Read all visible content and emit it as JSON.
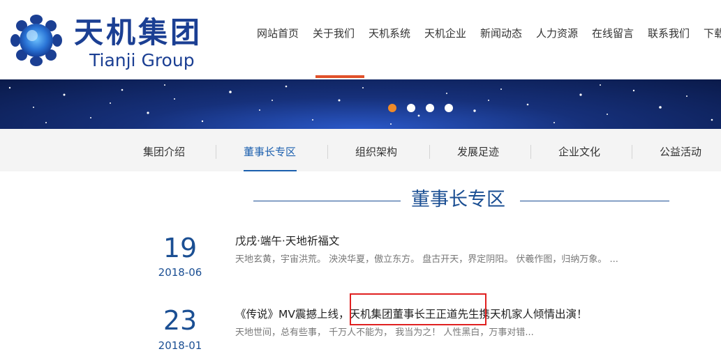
{
  "header": {
    "logo_cn": "天机集团",
    "logo_en": "Tianji Group",
    "nav": [
      "网站首页",
      "关于我们",
      "天机系统",
      "天机企业",
      "新闻动态",
      "人力资源",
      "在线留言",
      "联系我们",
      "下载"
    ]
  },
  "banner": {
    "active_slide": 1,
    "slide_count": 4
  },
  "subnav": [
    "集团介绍",
    "董事长专区",
    "组织架构",
    "发展足迹",
    "企业文化",
    "公益活动"
  ],
  "section": {
    "title": "董事长专区"
  },
  "articles": [
    {
      "day": "19",
      "ym": "2018-06",
      "title": "戊戌·端午·天地祈福文",
      "desc": "天地玄黄，宇宙洪荒。 泱泱华夏，傲立东方。 盘古开天，界定阴阳。 伏羲作图，归纳万象。 ..."
    },
    {
      "day": "23",
      "ym": "2018-01",
      "title": "《传说》MV震撼上线，天机集团董事长王正道先生携天机家人倾情出演！",
      "desc": "天地世间，总有些事， 千万人不能为， 我当为之！ 人性黑白，万事对错..."
    }
  ],
  "colors": {
    "brand": "#1b3f93",
    "accent": "#e0512a",
    "highlight": "#e02020"
  }
}
